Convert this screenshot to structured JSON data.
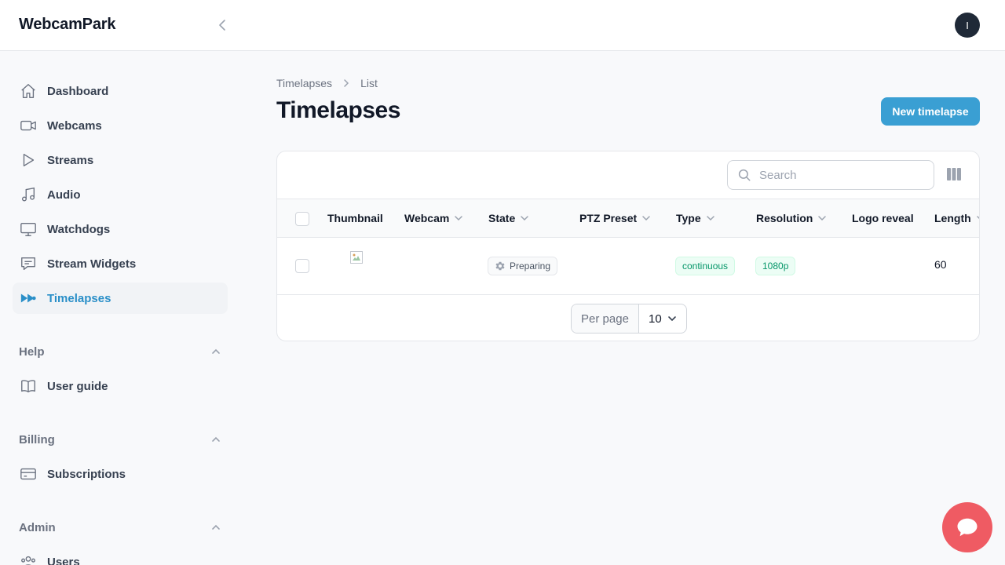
{
  "app": {
    "brand": "WebcamPark",
    "user_initial": "I"
  },
  "sidebar": {
    "items": [
      {
        "label": "Dashboard",
        "icon": "home-icon"
      },
      {
        "label": "Webcams",
        "icon": "video-camera-icon"
      },
      {
        "label": "Streams",
        "icon": "play-icon"
      },
      {
        "label": "Audio",
        "icon": "music-note-icon"
      },
      {
        "label": "Watchdogs",
        "icon": "monitor-icon"
      },
      {
        "label": "Stream Widgets",
        "icon": "chat-bubble-icon"
      },
      {
        "label": "Timelapses",
        "icon": "fast-forward-icon",
        "active": true
      }
    ],
    "groups": [
      {
        "label": "Help",
        "items": [
          {
            "label": "User guide",
            "icon": "book-icon"
          }
        ]
      },
      {
        "label": "Billing",
        "items": [
          {
            "label": "Subscriptions",
            "icon": "credit-card-icon"
          }
        ]
      },
      {
        "label": "Admin",
        "items": [
          {
            "label": "Users",
            "icon": "users-icon"
          }
        ]
      }
    ]
  },
  "breadcrumb": {
    "parent": "Timelapses",
    "current": "List"
  },
  "page": {
    "title": "Timelapses",
    "new_button": "New timelapse"
  },
  "table": {
    "search_placeholder": "Search",
    "columns": [
      "Thumbnail",
      "Webcam",
      "State",
      "PTZ Preset",
      "Type",
      "Resolution",
      "Logo reveal",
      "Length"
    ],
    "rows": [
      {
        "thumbnail": "",
        "webcam": "",
        "state": "Preparing",
        "ptz_preset": "",
        "type": "continuous",
        "resolution": "1080p",
        "logo_reveal": "",
        "length": "60"
      }
    ],
    "pagination": {
      "per_page_label": "Per page",
      "per_page_value": "10"
    }
  },
  "colors": {
    "accent": "#3a9fd3",
    "active_nav": "#2a8fc8",
    "chat": "#ef5b63"
  }
}
